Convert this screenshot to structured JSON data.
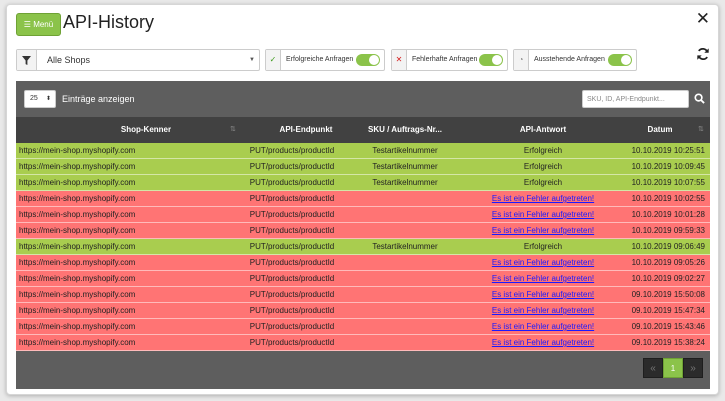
{
  "header": {
    "menu_label": "☰ Menü",
    "title": "API-History",
    "close_symbol": "✕"
  },
  "filters": {
    "shop_select": "Alle Shops",
    "toggles": [
      {
        "icon": "✓",
        "icon_color": "#3c9a1a",
        "label": "Erfolgreiche Anfragen",
        "on": true
      },
      {
        "icon": "✕",
        "icon_color": "#d62020",
        "label": "Fehlerhafte Anfragen",
        "on": true
      },
      {
        "icon": "◔",
        "icon_color": "#888888",
        "label": "Ausstehende Anfragen",
        "on": true
      }
    ]
  },
  "table": {
    "length_value": "25",
    "length_label": "Einträge anzeigen",
    "search_placeholder": "SKU, ID, API-Endpunkt...",
    "columns": [
      "Shop-Kenner",
      "API-Endpunkt",
      "SKU / Auftrags-Nr...",
      "API-Antwort",
      "Datum"
    ],
    "rows": [
      {
        "status": "ok",
        "shop": "https://mein-shop.myshopify.com",
        "endpoint": "PUT/products/productId",
        "sku": "Testartikelnummer",
        "response": "Erfolgreich",
        "date": "10.10.2019 10:25:51"
      },
      {
        "status": "ok",
        "shop": "https://mein-shop.myshopify.com",
        "endpoint": "PUT/products/productId",
        "sku": "Testartikelnummer",
        "response": "Erfolgreich",
        "date": "10.10.2019 10:09:45"
      },
      {
        "status": "ok",
        "shop": "https://mein-shop.myshopify.com",
        "endpoint": "PUT/products/productId",
        "sku": "Testartikelnummer",
        "response": "Erfolgreich",
        "date": "10.10.2019 10:07:55"
      },
      {
        "status": "err",
        "shop": "https://mein-shop.myshopify.com",
        "endpoint": "PUT/products/productId",
        "sku": "",
        "response": "Es ist ein Fehler aufgetreten!",
        "date": "10.10.2019 10:02:55"
      },
      {
        "status": "err",
        "shop": "https://mein-shop.myshopify.com",
        "endpoint": "PUT/products/productId",
        "sku": "",
        "response": "Es ist ein Fehler aufgetreten!",
        "date": "10.10.2019 10:01:28"
      },
      {
        "status": "err",
        "shop": "https://mein-shop.myshopify.com",
        "endpoint": "PUT/products/productId",
        "sku": "",
        "response": "Es ist ein Fehler aufgetreten!",
        "date": "10.10.2019 09:59:33"
      },
      {
        "status": "ok",
        "shop": "https://mein-shop.myshopify.com",
        "endpoint": "PUT/products/productId",
        "sku": "Testartikelnummer",
        "response": "Erfolgreich",
        "date": "10.10.2019 09:06:49"
      },
      {
        "status": "err",
        "shop": "https://mein-shop.myshopify.com",
        "endpoint": "PUT/products/productId",
        "sku": "",
        "response": "Es ist ein Fehler aufgetreten!",
        "date": "10.10.2019 09:05:26"
      },
      {
        "status": "err",
        "shop": "https://mein-shop.myshopify.com",
        "endpoint": "PUT/products/productId",
        "sku": "",
        "response": "Es ist ein Fehler aufgetreten!",
        "date": "10.10.2019 09:02:27"
      },
      {
        "status": "err",
        "shop": "https://mein-shop.myshopify.com",
        "endpoint": "PUT/products/productId",
        "sku": "",
        "response": "Es ist ein Fehler aufgetreten!",
        "date": "09.10.2019 15:50:08"
      },
      {
        "status": "err",
        "shop": "https://mein-shop.myshopify.com",
        "endpoint": "PUT/products/productId",
        "sku": "",
        "response": "Es ist ein Fehler aufgetreten!",
        "date": "09.10.2019 15:47:34"
      },
      {
        "status": "err",
        "shop": "https://mein-shop.myshopify.com",
        "endpoint": "PUT/products/productId",
        "sku": "",
        "response": "Es ist ein Fehler aufgetreten!",
        "date": "09.10.2019 15:43:46"
      },
      {
        "status": "err",
        "shop": "https://mein-shop.myshopify.com",
        "endpoint": "PUT/products/productId",
        "sku": "",
        "response": "Es ist ein Fehler aufgetreten!",
        "date": "09.10.2019 15:38:24"
      }
    ]
  },
  "pagination": {
    "prev": "«",
    "current": "1",
    "next": "»"
  },
  "colors": {
    "accent": "#8bc34a",
    "success_row": "#a9cd4f",
    "error_row": "#ff7474",
    "link": "#1a1aff"
  }
}
